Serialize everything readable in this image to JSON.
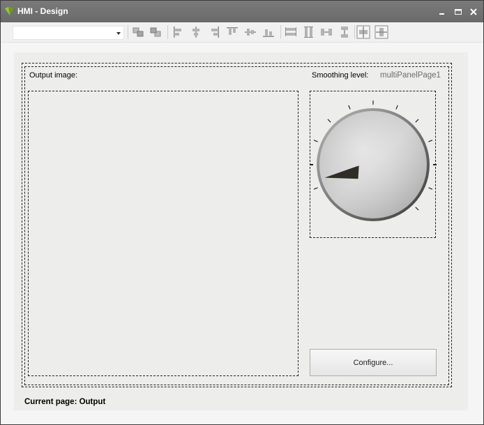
{
  "window": {
    "title": "HMI - Design"
  },
  "toolbar": {
    "combo_value": "",
    "icons": [
      "bring-to-front-icon",
      "send-to-back-icon",
      "align-lefts-icon",
      "align-centers-icon",
      "align-rights-icon",
      "align-tops-icon",
      "align-middles-icon",
      "align-bottoms-icon",
      "make-same-width-icon",
      "make-same-height-icon",
      "horizontal-spacing-icon",
      "vertical-spacing-icon",
      "center-horizontally-icon",
      "center-vertically-icon"
    ]
  },
  "form": {
    "output_label": "Output image:",
    "smoothing_label": "Smoothing level:",
    "page_name": "multiPanelPage1",
    "configure_label": "Configure...",
    "status_text": "Current page: Output"
  },
  "knob": {
    "level": 0.0
  },
  "colors": {
    "titlebar": "#707070",
    "form_bg": "#ededeb",
    "needle": "#2e2e26"
  }
}
